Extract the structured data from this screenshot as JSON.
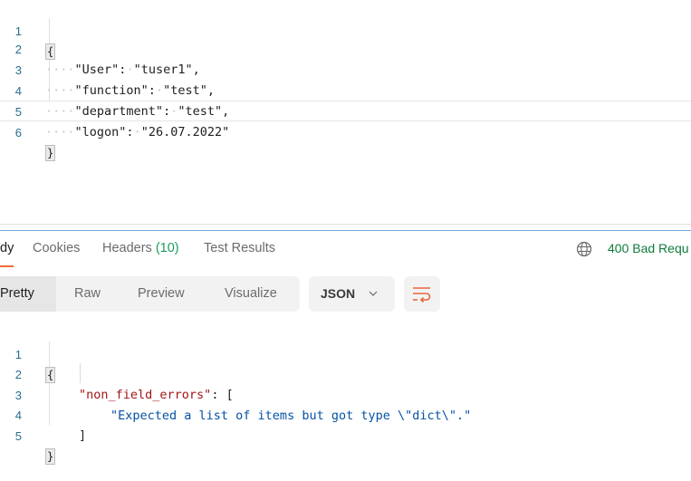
{
  "request_body": {
    "lines": [
      {
        "num": "1",
        "text": "{"
      },
      {
        "num": "2",
        "key": "\"User\"",
        "value": "\"tuser1\"",
        "trail": ","
      },
      {
        "num": "3",
        "key": "\"function\"",
        "value": "\"test\"",
        "trail": ","
      },
      {
        "num": "4",
        "key": "\"department\"",
        "value": "\"test\"",
        "trail": ","
      },
      {
        "num": "5",
        "key": "\"logon\"",
        "value": "\"26.07.2022\"",
        "trail": ""
      },
      {
        "num": "6",
        "text": "}"
      }
    ],
    "indent_dots": "····",
    "separator": ":",
    "sep_dot": "·"
  },
  "response": {
    "tabs": [
      {
        "label": "dy",
        "active": true
      },
      {
        "label": "Cookies"
      },
      {
        "label": "Headers",
        "count": "(10)"
      },
      {
        "label": "Test Results"
      }
    ],
    "status": "400 Bad Requ",
    "status_color": "#0f7b3b",
    "view_modes": [
      "Pretty",
      "Raw",
      "Preview",
      "Visualize"
    ],
    "active_view_mode": "Pretty",
    "format": "JSON",
    "body": {
      "lines": [
        {
          "num": "1",
          "text": "{"
        },
        {
          "num": "2",
          "key": "\"non_field_errors\"",
          "trail": ": ["
        },
        {
          "num": "3",
          "value": "\"Expected a list of items but got type \\\"dict\\\".\""
        },
        {
          "num": "4",
          "text": "]"
        },
        {
          "num": "5",
          "text": "}"
        }
      ]
    }
  },
  "colors": {
    "accent": "#f26b3a",
    "count_green": "#1a9c5c",
    "json_key": "#a31515",
    "json_string": "#0451a5",
    "line_number": "#2b6e8f"
  }
}
